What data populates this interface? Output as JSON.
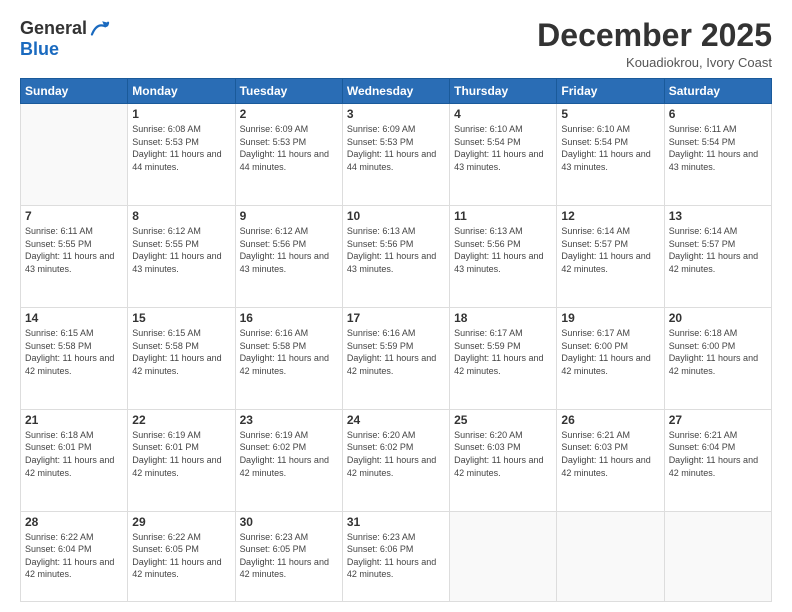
{
  "header": {
    "logo_general": "General",
    "logo_blue": "Blue",
    "month_title": "December 2025",
    "location": "Kouadiokrou, Ivory Coast"
  },
  "days_of_week": [
    "Sunday",
    "Monday",
    "Tuesday",
    "Wednesday",
    "Thursday",
    "Friday",
    "Saturday"
  ],
  "weeks": [
    [
      {
        "day": "",
        "sunrise": "",
        "sunset": "",
        "daylight": ""
      },
      {
        "day": "1",
        "sunrise": "Sunrise: 6:08 AM",
        "sunset": "Sunset: 5:53 PM",
        "daylight": "Daylight: 11 hours and 44 minutes."
      },
      {
        "day": "2",
        "sunrise": "Sunrise: 6:09 AM",
        "sunset": "Sunset: 5:53 PM",
        "daylight": "Daylight: 11 hours and 44 minutes."
      },
      {
        "day": "3",
        "sunrise": "Sunrise: 6:09 AM",
        "sunset": "Sunset: 5:53 PM",
        "daylight": "Daylight: 11 hours and 44 minutes."
      },
      {
        "day": "4",
        "sunrise": "Sunrise: 6:10 AM",
        "sunset": "Sunset: 5:54 PM",
        "daylight": "Daylight: 11 hours and 43 minutes."
      },
      {
        "day": "5",
        "sunrise": "Sunrise: 6:10 AM",
        "sunset": "Sunset: 5:54 PM",
        "daylight": "Daylight: 11 hours and 43 minutes."
      },
      {
        "day": "6",
        "sunrise": "Sunrise: 6:11 AM",
        "sunset": "Sunset: 5:54 PM",
        "daylight": "Daylight: 11 hours and 43 minutes."
      }
    ],
    [
      {
        "day": "7",
        "sunrise": "Sunrise: 6:11 AM",
        "sunset": "Sunset: 5:55 PM",
        "daylight": "Daylight: 11 hours and 43 minutes."
      },
      {
        "day": "8",
        "sunrise": "Sunrise: 6:12 AM",
        "sunset": "Sunset: 5:55 PM",
        "daylight": "Daylight: 11 hours and 43 minutes."
      },
      {
        "day": "9",
        "sunrise": "Sunrise: 6:12 AM",
        "sunset": "Sunset: 5:56 PM",
        "daylight": "Daylight: 11 hours and 43 minutes."
      },
      {
        "day": "10",
        "sunrise": "Sunrise: 6:13 AM",
        "sunset": "Sunset: 5:56 PM",
        "daylight": "Daylight: 11 hours and 43 minutes."
      },
      {
        "day": "11",
        "sunrise": "Sunrise: 6:13 AM",
        "sunset": "Sunset: 5:56 PM",
        "daylight": "Daylight: 11 hours and 43 minutes."
      },
      {
        "day": "12",
        "sunrise": "Sunrise: 6:14 AM",
        "sunset": "Sunset: 5:57 PM",
        "daylight": "Daylight: 11 hours and 42 minutes."
      },
      {
        "day": "13",
        "sunrise": "Sunrise: 6:14 AM",
        "sunset": "Sunset: 5:57 PM",
        "daylight": "Daylight: 11 hours and 42 minutes."
      }
    ],
    [
      {
        "day": "14",
        "sunrise": "Sunrise: 6:15 AM",
        "sunset": "Sunset: 5:58 PM",
        "daylight": "Daylight: 11 hours and 42 minutes."
      },
      {
        "day": "15",
        "sunrise": "Sunrise: 6:15 AM",
        "sunset": "Sunset: 5:58 PM",
        "daylight": "Daylight: 11 hours and 42 minutes."
      },
      {
        "day": "16",
        "sunrise": "Sunrise: 6:16 AM",
        "sunset": "Sunset: 5:58 PM",
        "daylight": "Daylight: 11 hours and 42 minutes."
      },
      {
        "day": "17",
        "sunrise": "Sunrise: 6:16 AM",
        "sunset": "Sunset: 5:59 PM",
        "daylight": "Daylight: 11 hours and 42 minutes."
      },
      {
        "day": "18",
        "sunrise": "Sunrise: 6:17 AM",
        "sunset": "Sunset: 5:59 PM",
        "daylight": "Daylight: 11 hours and 42 minutes."
      },
      {
        "day": "19",
        "sunrise": "Sunrise: 6:17 AM",
        "sunset": "Sunset: 6:00 PM",
        "daylight": "Daylight: 11 hours and 42 minutes."
      },
      {
        "day": "20",
        "sunrise": "Sunrise: 6:18 AM",
        "sunset": "Sunset: 6:00 PM",
        "daylight": "Daylight: 11 hours and 42 minutes."
      }
    ],
    [
      {
        "day": "21",
        "sunrise": "Sunrise: 6:18 AM",
        "sunset": "Sunset: 6:01 PM",
        "daylight": "Daylight: 11 hours and 42 minutes."
      },
      {
        "day": "22",
        "sunrise": "Sunrise: 6:19 AM",
        "sunset": "Sunset: 6:01 PM",
        "daylight": "Daylight: 11 hours and 42 minutes."
      },
      {
        "day": "23",
        "sunrise": "Sunrise: 6:19 AM",
        "sunset": "Sunset: 6:02 PM",
        "daylight": "Daylight: 11 hours and 42 minutes."
      },
      {
        "day": "24",
        "sunrise": "Sunrise: 6:20 AM",
        "sunset": "Sunset: 6:02 PM",
        "daylight": "Daylight: 11 hours and 42 minutes."
      },
      {
        "day": "25",
        "sunrise": "Sunrise: 6:20 AM",
        "sunset": "Sunset: 6:03 PM",
        "daylight": "Daylight: 11 hours and 42 minutes."
      },
      {
        "day": "26",
        "sunrise": "Sunrise: 6:21 AM",
        "sunset": "Sunset: 6:03 PM",
        "daylight": "Daylight: 11 hours and 42 minutes."
      },
      {
        "day": "27",
        "sunrise": "Sunrise: 6:21 AM",
        "sunset": "Sunset: 6:04 PM",
        "daylight": "Daylight: 11 hours and 42 minutes."
      }
    ],
    [
      {
        "day": "28",
        "sunrise": "Sunrise: 6:22 AM",
        "sunset": "Sunset: 6:04 PM",
        "daylight": "Daylight: 11 hours and 42 minutes."
      },
      {
        "day": "29",
        "sunrise": "Sunrise: 6:22 AM",
        "sunset": "Sunset: 6:05 PM",
        "daylight": "Daylight: 11 hours and 42 minutes."
      },
      {
        "day": "30",
        "sunrise": "Sunrise: 6:23 AM",
        "sunset": "Sunset: 6:05 PM",
        "daylight": "Daylight: 11 hours and 42 minutes."
      },
      {
        "day": "31",
        "sunrise": "Sunrise: 6:23 AM",
        "sunset": "Sunset: 6:06 PM",
        "daylight": "Daylight: 11 hours and 42 minutes."
      },
      {
        "day": "",
        "sunrise": "",
        "sunset": "",
        "daylight": ""
      },
      {
        "day": "",
        "sunrise": "",
        "sunset": "",
        "daylight": ""
      },
      {
        "day": "",
        "sunrise": "",
        "sunset": "",
        "daylight": ""
      }
    ]
  ]
}
